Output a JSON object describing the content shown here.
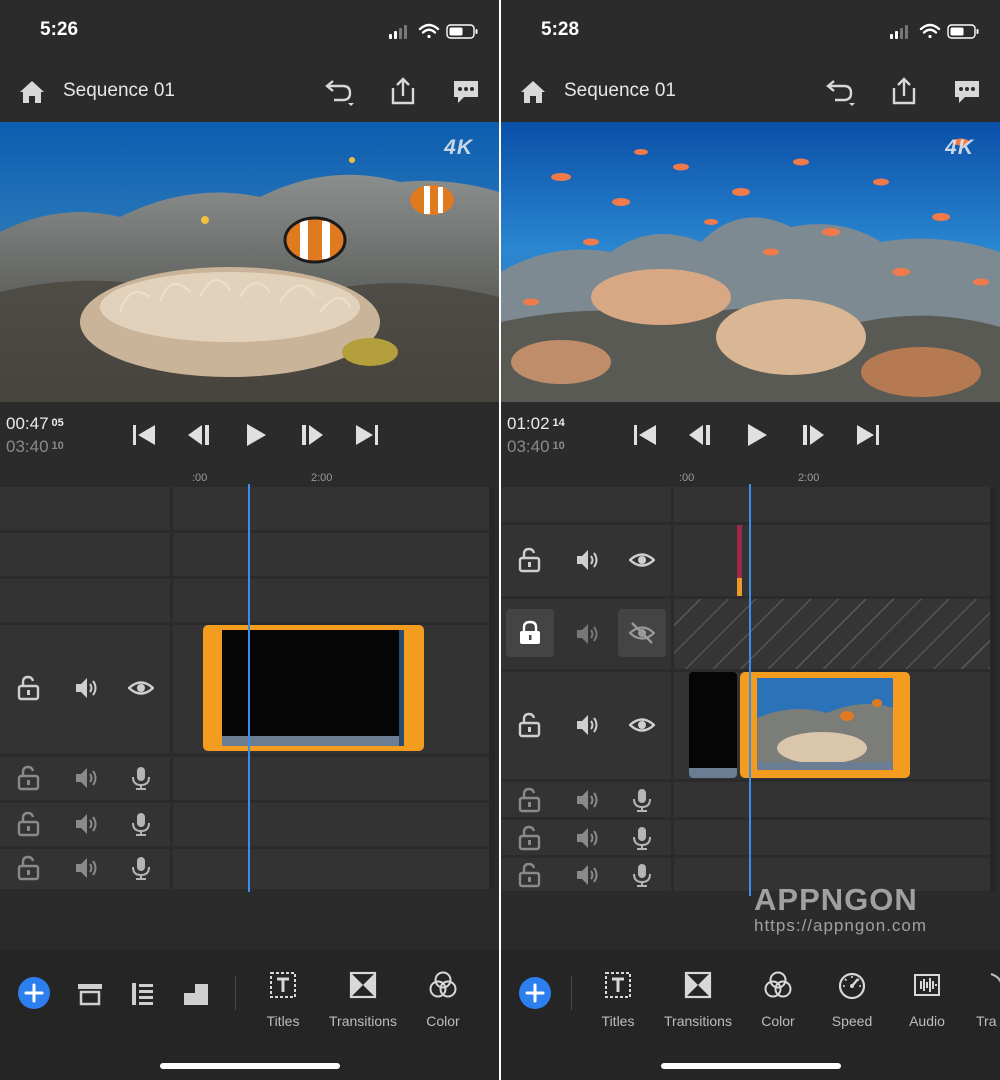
{
  "left": {
    "status_time": "5:26",
    "title": "Sequence 01",
    "badge": "4K",
    "timecode_current": "00:47",
    "timecode_current_frames": "05",
    "timecode_total": "03:40",
    "timecode_total_frames": "10",
    "ruler": [
      ":00",
      "2:00"
    ],
    "tools": [
      {
        "label": "Titles",
        "icon": "titles-icon"
      },
      {
        "label": "Transitions",
        "icon": "transitions-icon"
      },
      {
        "label": "Color",
        "icon": "color-icon"
      }
    ]
  },
  "right": {
    "status_time": "5:28",
    "title": "Sequence 01",
    "badge": "4K",
    "timecode_current": "01:02",
    "timecode_current_frames": "14",
    "timecode_total": "03:40",
    "timecode_total_frames": "10",
    "ruler": [
      ":00",
      "2:00"
    ],
    "tools": [
      {
        "label": "Titles",
        "icon": "titles-icon"
      },
      {
        "label": "Transitions",
        "icon": "transitions-icon"
      },
      {
        "label": "Color",
        "icon": "color-icon"
      },
      {
        "label": "Speed",
        "icon": "speed-icon"
      },
      {
        "label": "Audio",
        "icon": "audio-icon"
      },
      {
        "label": "Tra",
        "icon": "transform-icon"
      }
    ]
  },
  "watermark": {
    "logo": "APPNGON",
    "url": "https://appngon.com"
  },
  "colors": {
    "accent_blue": "#2d7ff0",
    "playhead": "#3b8ee8",
    "clip_selected": "#f39c1f",
    "background": "#2b2b2b"
  }
}
